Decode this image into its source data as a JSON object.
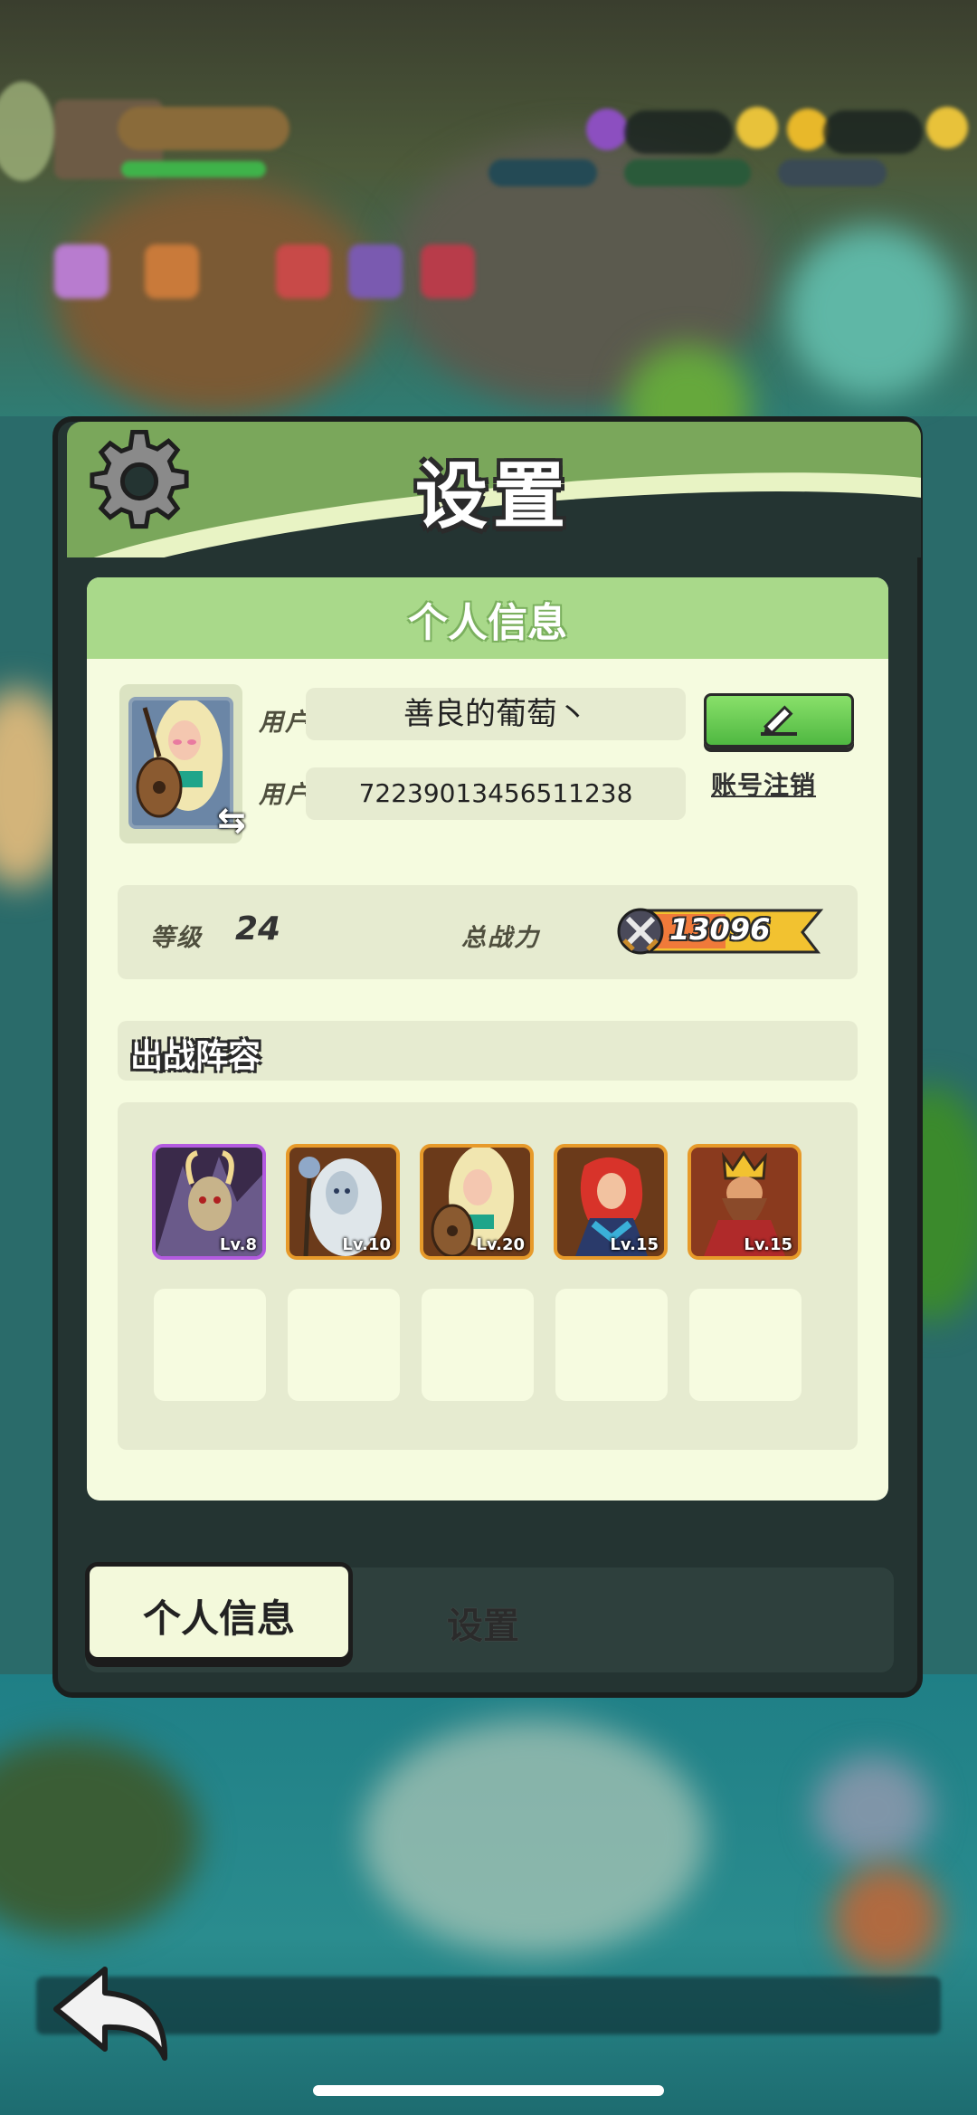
{
  "dialog": {
    "title": "设置",
    "panel_title": "个人信息",
    "profile": {
      "nickname_label": "用户昵称",
      "nickname_value": "善良的葡萄丶",
      "id_label": "用户  ID",
      "id_value": "72239013456511238",
      "account_cancel": "账号注销"
    },
    "stats": {
      "level_label": "等级",
      "level_value": "24",
      "power_label": "总战力",
      "power_value": "13096"
    },
    "lineup": {
      "title": "出战阵容",
      "heroes": [
        {
          "level": "Lv.8",
          "rarity": "purple"
        },
        {
          "level": "Lv.10",
          "rarity": "orange"
        },
        {
          "level": "Lv.20",
          "rarity": "orange"
        },
        {
          "level": "Lv.15",
          "rarity": "orange"
        },
        {
          "level": "Lv.15",
          "rarity": "orange"
        }
      ]
    },
    "tabs": {
      "personal_info": "个人信息",
      "settings": "设置"
    }
  },
  "colors": {
    "header_green": "#7aa75b",
    "panel_bg": "#f5fbdf",
    "panel_header": "#a9d98a",
    "field_bg": "#e6ebd0",
    "edit_button": "#5ec94a",
    "purple_frame": "#b35be0",
    "orange_frame": "#e79a2a",
    "power_badge": "#f2c230"
  },
  "icons": {
    "gear": "gear-icon",
    "edit": "pencil-icon",
    "swap": "swap-icon",
    "power": "crossed-swords-icon",
    "back": "back-arrow-icon"
  }
}
